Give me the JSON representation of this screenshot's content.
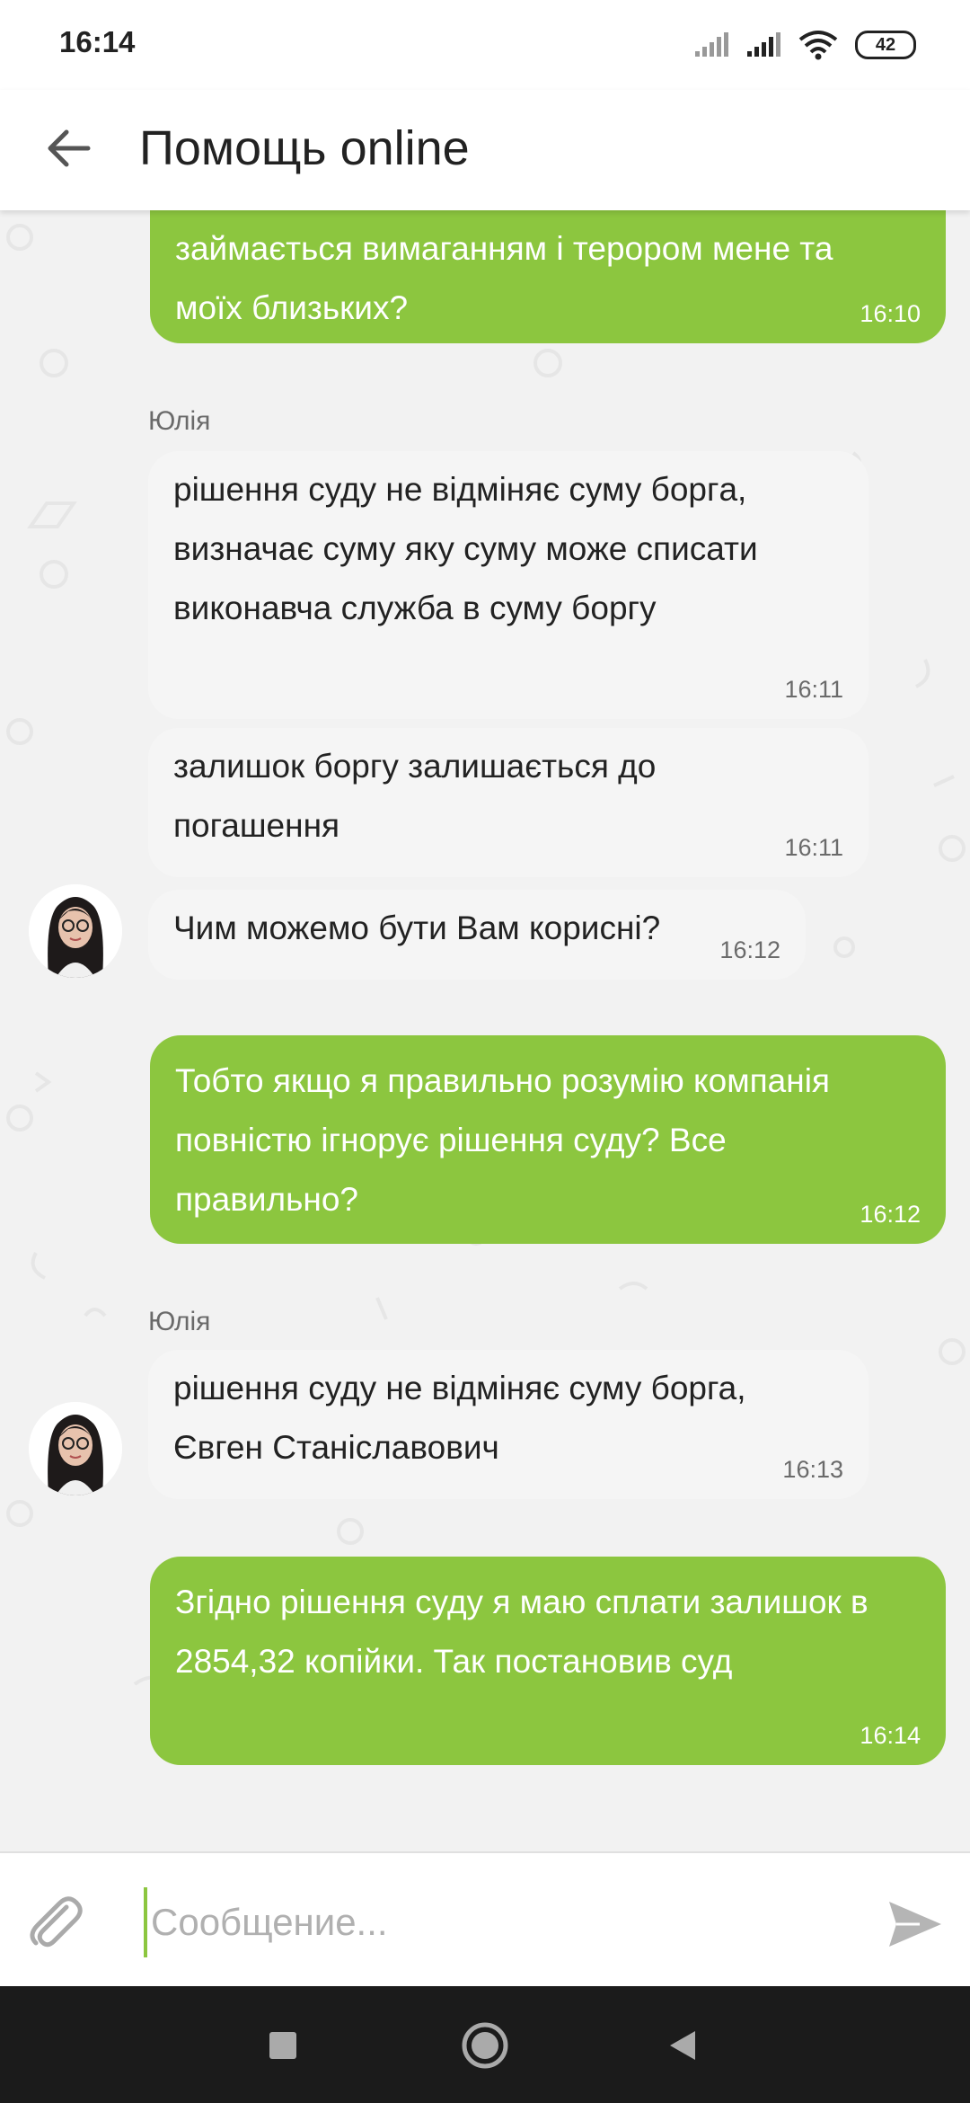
{
  "status_bar": {
    "time": "16:14",
    "battery": "42",
    "icons": [
      "signal-icon",
      "signal-icon",
      "wifi-icon",
      "battery-icon"
    ]
  },
  "app_bar": {
    "title": "Помощь online",
    "back_icon": "arrow-left-icon"
  },
  "messages": [
    {
      "direction": "out",
      "text": "займається вимаганням і терором мене та моїх близьких?",
      "time": "16:10"
    },
    {
      "direction": "in",
      "sender": "Юлія",
      "text": "рішення суду не відміняє суму боргa, визначає суму яку суму може списати виконавча служба в суму боргу",
      "time": "16:11"
    },
    {
      "direction": "in",
      "text": "залишок боргу залишається до погашення",
      "time": "16:11"
    },
    {
      "direction": "in",
      "text": "Чим можемо бути Вам корисні?",
      "time": "16:12",
      "avatar": true
    },
    {
      "direction": "out",
      "text": "Тобто якщо я правильно розумію компанія повністю ігнорує рішення суду? Все правильно?",
      "time": "16:12"
    },
    {
      "direction": "in",
      "sender": "Юлія",
      "text": "рішення суду не відміняє суму борга,  Євген Станіславович",
      "time": "16:13",
      "avatar": true
    },
    {
      "direction": "out",
      "text": "Згідно рішення суду я маю сплати залишок в 2854,32 копійки. Так постановив суд",
      "time": "16:14"
    }
  ],
  "composer": {
    "placeholder": "Сообщение...",
    "value": "",
    "attach_icon": "paperclip-icon",
    "send_icon": "send-icon"
  },
  "nav_bar": {
    "icons": [
      "recent-apps-icon",
      "home-icon",
      "back-icon"
    ]
  },
  "colors": {
    "accent": "#8cc63f",
    "incoming_bubble": "#f5f5f5",
    "background": "#f2f2f2"
  }
}
